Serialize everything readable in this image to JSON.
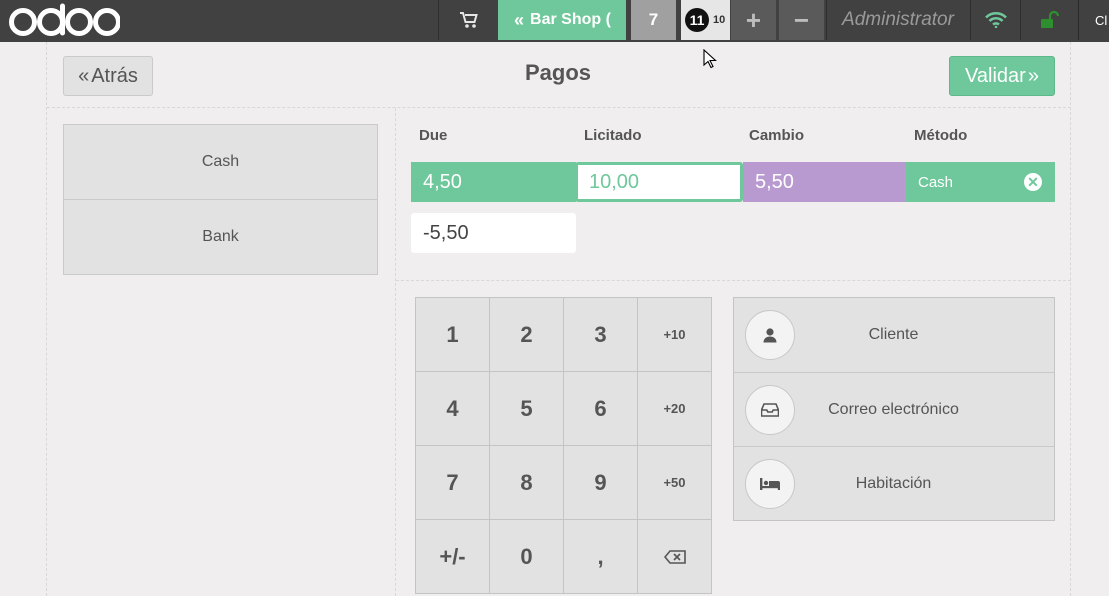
{
  "topbar": {
    "brand": "odoo",
    "shop_label": "Bar Shop (",
    "orders": [
      {
        "label": "7"
      },
      {
        "label": "11",
        "sub": "10"
      }
    ],
    "add_order": "+",
    "remove_order": "−",
    "user": "Administrator",
    "close_label": "Cl",
    "icons": [
      "cart-icon",
      "wifi-icon",
      "lock-icon"
    ],
    "colors": {
      "bar": "#414141",
      "accent": "#6ec89b",
      "wifi": "#6ec89b",
      "lock": "#2d8f2d"
    }
  },
  "header": {
    "back_label": "Atrás",
    "title": "Pagos",
    "validate_label": "Validar"
  },
  "payment_methods": [
    "Cash",
    "Bank"
  ],
  "paymentlines": {
    "columns": [
      "Due",
      "Licitado",
      "Cambio",
      "Método"
    ],
    "line": {
      "due": "4,50",
      "tendered": "10,00",
      "change": "5,50",
      "method": "Cash"
    },
    "remaining": "-5,50",
    "colors": {
      "due": "#6ec89b",
      "change": "#b89ad1",
      "method": "#6ec89b"
    }
  },
  "numpad": {
    "keys": [
      [
        "1",
        "2",
        "3",
        "+10"
      ],
      [
        "4",
        "5",
        "6",
        "+20"
      ],
      [
        "7",
        "8",
        "9",
        "+50"
      ],
      [
        "+/-",
        "0",
        ",",
        "⌫"
      ]
    ]
  },
  "actions": [
    {
      "label": "Cliente",
      "icon": "user-icon"
    },
    {
      "label": "Correo electrónico",
      "icon": "inbox-icon"
    },
    {
      "label": "Habitación",
      "icon": "bed-icon"
    }
  ]
}
